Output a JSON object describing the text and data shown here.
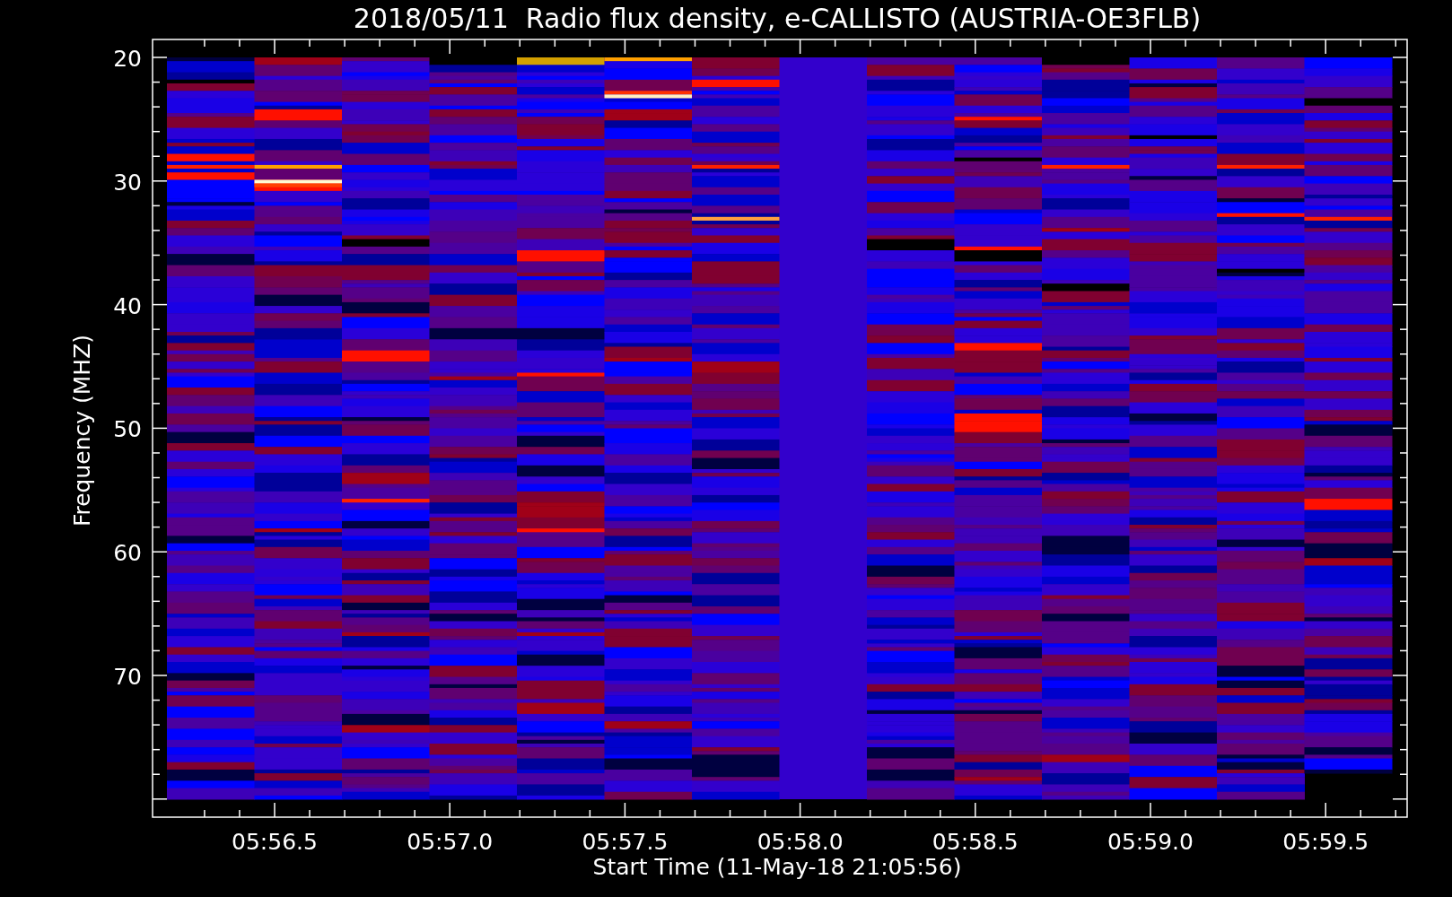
{
  "chart": {
    "title": "2018/05/11  Radio flux density, e-CALLISTO (AUSTRIA-OE3FLB)",
    "x_axis": {
      "label": "Start Time (11-May-18 21:05:56)",
      "ticks": [
        "05:56.5",
        "05:57.0",
        "05:57.5",
        "05:58.0",
        "05:58.5",
        "05:59.0",
        "05:59.5"
      ]
    },
    "y_axis": {
      "label": "Frequency (MHZ)",
      "ticks": [
        "20",
        "30",
        "40",
        "50",
        "60",
        "70"
      ]
    }
  }
}
